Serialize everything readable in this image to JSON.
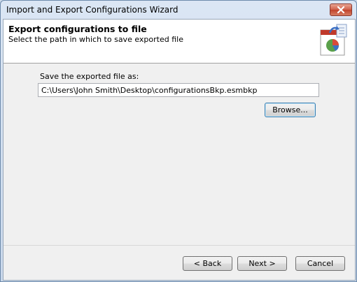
{
  "window": {
    "title": "Import and Export Configurations Wizard"
  },
  "header": {
    "title": "Export configurations to file",
    "subtitle": "Select the path in which to save exported file",
    "icon": "export-config-icon"
  },
  "form": {
    "label": "Save the exported file as:",
    "path_value": "C:\\Users\\John Smith\\Desktop\\configurationsBkp.esmbkp",
    "browse_label": "Browse..."
  },
  "footer": {
    "back_label": "< Back",
    "next_label": "Next >",
    "cancel_label": "Cancel"
  },
  "colors": {
    "accent": "#3c7fb1",
    "close_button": "#c0432c"
  }
}
